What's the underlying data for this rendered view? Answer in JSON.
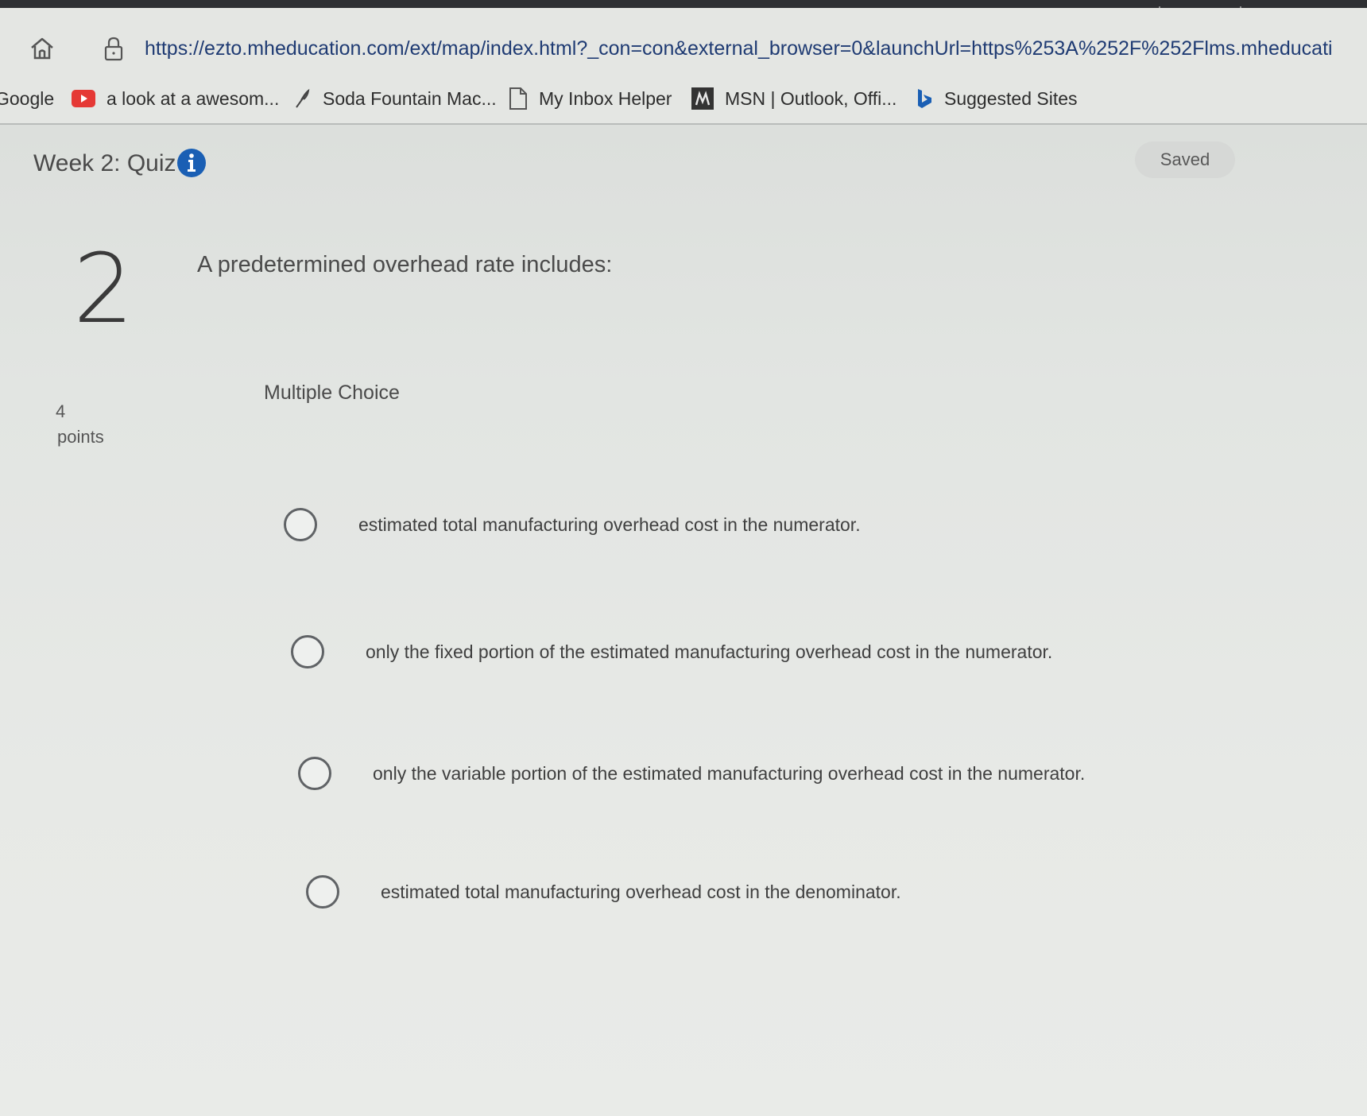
{
  "browser": {
    "url": "https://ezto.mheducation.com/ext/map/index.html?_con=con&external_browser=0&launchUrl=https%253A%252F%252Flms.mheducati",
    "bookmarks": [
      {
        "label": "Google",
        "icon": "google-icon"
      },
      {
        "label": "a look at a awesom...",
        "icon": "youtube-icon"
      },
      {
        "label": "Soda Fountain Mac...",
        "icon": "feather-icon"
      },
      {
        "label": "My Inbox Helper",
        "icon": "document-icon"
      },
      {
        "label": "MSN | Outlook, Offi...",
        "icon": "msn-icon"
      },
      {
        "label": "Suggested Sites",
        "icon": "bing-icon"
      }
    ]
  },
  "quiz": {
    "title": "Week 2: Quiz",
    "status": "Saved"
  },
  "question": {
    "number": "2",
    "text": "A predetermined overhead rate includes:",
    "points_value": "4",
    "points_label": "points",
    "type": "Multiple Choice",
    "choices": [
      {
        "label": "estimated total manufacturing overhead cost in the numerator."
      },
      {
        "label": "only the fixed portion of the estimated manufacturing overhead cost in the numerator."
      },
      {
        "label": "only the variable portion of the estimated manufacturing overhead cost in the numerator."
      },
      {
        "label": "estimated total manufacturing overhead cost in the denominator."
      }
    ]
  },
  "colors": {
    "accent": "#1a5fb4",
    "url": "#1f3b73",
    "youtube_red": "#e53935"
  }
}
